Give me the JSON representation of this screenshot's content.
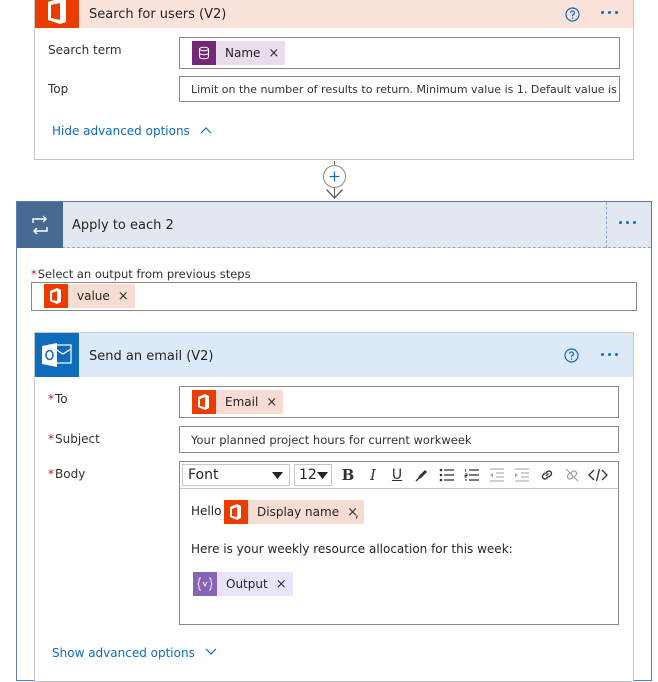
{
  "search_card": {
    "title": "Search for users (V2)",
    "fields": {
      "search_term_label": "Search term",
      "search_term_token": "Name",
      "top_label": "Top",
      "top_placeholder": "Limit on the number of results to return. Minimum value is 1. Default value is 10."
    },
    "advanced_toggle": "Hide advanced options"
  },
  "apply_each": {
    "title": "Apply to each 2",
    "select_label": "Select an output from previous steps",
    "select_token": "value"
  },
  "email_card": {
    "title": "Send an email (V2)",
    "to_label": "To",
    "to_token": "Email",
    "subject_label": "Subject",
    "subject_value": "Your planned project hours for current workweek",
    "body_label": "Body",
    "toolbar": {
      "font": "Font",
      "size": "12",
      "bold": "B",
      "italic": "I",
      "underline": "U"
    },
    "body": {
      "greeting": "Hello",
      "display_name_token": "Display name",
      "punct": ",",
      "line2": "Here is your weekly resource allocation for this week:",
      "output_token": "Output"
    },
    "advanced_toggle": "Show advanced options"
  },
  "token_remove": "×",
  "colors": {
    "office_red": "#eb3c00",
    "dataverse_purple": "#742774",
    "variable_violet": "#8764b8",
    "outlook_blue": "#0f6cbd",
    "loop_blue": "#486991",
    "link_blue": "#0f6cbd"
  },
  "icons": [
    "office-logo-icon",
    "database-icon",
    "help-icon",
    "more-options-icon",
    "add-step-icon",
    "arrow-down-icon",
    "loop-icon",
    "outlook-icon",
    "variable-icon",
    "chevron-up-icon",
    "chevron-down-icon",
    "bold-icon",
    "italic-icon",
    "underline-icon",
    "pen-icon",
    "bulleted-list-icon",
    "numbered-list-icon",
    "decrease-indent-icon",
    "increase-indent-icon",
    "link-icon",
    "unlink-icon",
    "code-view-icon"
  ]
}
